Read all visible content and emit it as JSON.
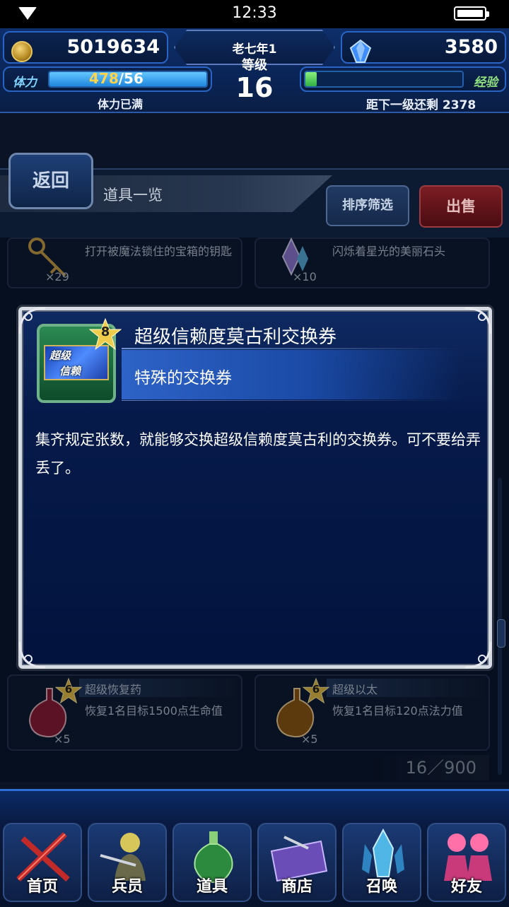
{
  "status_bar": {
    "time": "12:33"
  },
  "header": {
    "gil": "5019634",
    "gems": "3580",
    "stamina": {
      "label": "体力",
      "current": "478",
      "max": "/56",
      "status": "体力已满",
      "fill": 1.0
    },
    "player": {
      "name": "老七年1",
      "level_label": "等级",
      "level": "16"
    },
    "exp": {
      "label": "经验",
      "remaining_text": "距下一级还剩 2378",
      "fill": 0.07
    },
    "colors": {
      "stamina_bar": "#2b9bf0",
      "exp_bar": "#5bd36b",
      "accent": "#2a64c4"
    }
  },
  "titlebar": {
    "back_label": "返回",
    "title": "道具一览",
    "sort_label": "排序筛选",
    "sell_label": "出售"
  },
  "list": {
    "items_top": [
      {
        "desc": "打开被魔法锁住的宝箱的钥匙",
        "qty": "×29",
        "icon": "key-icon"
      },
      {
        "desc": "闪烁着星光的美丽石头",
        "qty": "×10",
        "icon": "crystal-icon"
      }
    ],
    "items_bottom": [
      {
        "rank": "6",
        "name": "超级恢复药",
        "desc": "恢复1名目标1500点生命值",
        "qty": "×5",
        "icon": "potion-icon"
      },
      {
        "rank": "6",
        "name": "超级以太",
        "desc": "恢复1名目标120点法力值",
        "qty": "×5",
        "icon": "ether-icon"
      }
    ],
    "count": "16／900"
  },
  "popup": {
    "rank": "8",
    "icon_text_1": "超级",
    "icon_text_2": "信赖",
    "name": "超级信赖度莫古利交换券",
    "category": "特殊的交换券",
    "description": "集齐规定张数，就能够交换超级信赖度莫古利的交换券。可不要给弄丢了。"
  },
  "nav": [
    {
      "label": "首页",
      "icon": "home-icon"
    },
    {
      "label": "兵员",
      "icon": "units-icon"
    },
    {
      "label": "道具",
      "icon": "items-icon"
    },
    {
      "label": "商店",
      "icon": "shop-icon"
    },
    {
      "label": "召唤",
      "icon": "summon-icon"
    },
    {
      "label": "好友",
      "icon": "friends-icon"
    }
  ]
}
